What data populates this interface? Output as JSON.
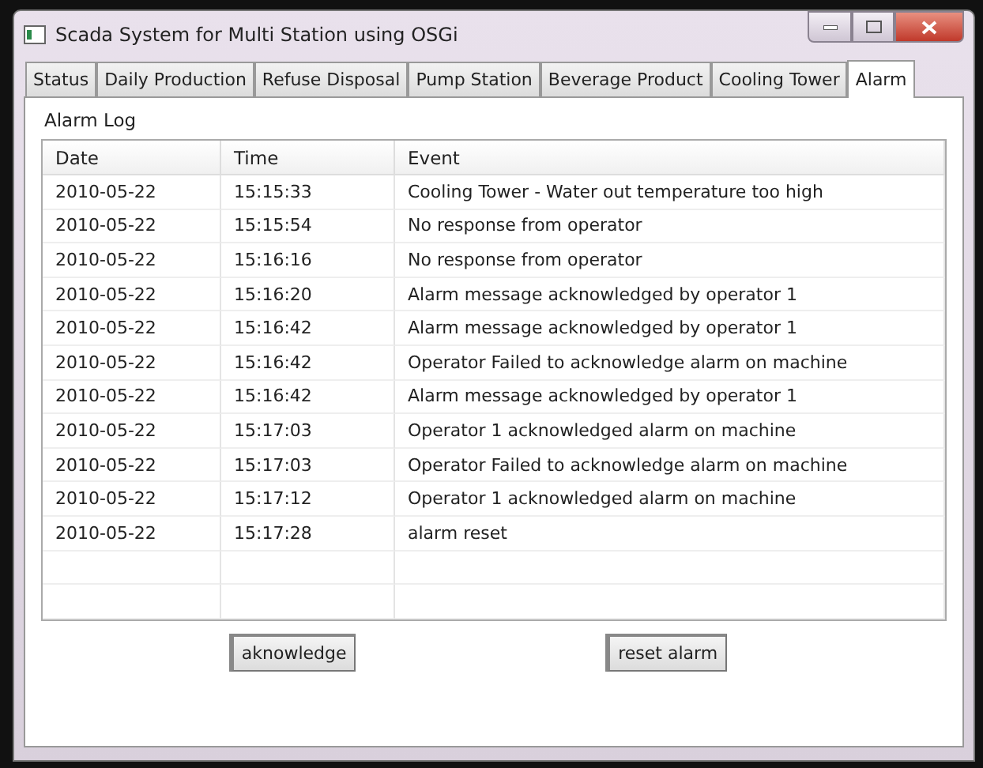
{
  "window": {
    "title": "Scada System for Multi Station using OSGi"
  },
  "tabs": [
    {
      "label": "Status",
      "selected": false
    },
    {
      "label": "Daily Production",
      "selected": false
    },
    {
      "label": "Refuse Disposal",
      "selected": false
    },
    {
      "label": "Pump Station",
      "selected": false
    },
    {
      "label": "Beverage Product",
      "selected": false
    },
    {
      "label": "Cooling Tower",
      "selected": false
    },
    {
      "label": "Alarm",
      "selected": true
    }
  ],
  "panel_title": "Alarm Log",
  "table": {
    "columns": [
      "Date",
      "Time",
      "Event"
    ],
    "rows": [
      [
        "2010-05-22",
        "15:15:33",
        "Cooling Tower - Water out temperature too high"
      ],
      [
        "2010-05-22",
        "15:15:54",
        "No response from operator"
      ],
      [
        "2010-05-22",
        "15:16:16",
        "No response from operator"
      ],
      [
        "2010-05-22",
        "15:16:20",
        "Alarm message acknowledged by operator 1"
      ],
      [
        "2010-05-22",
        "15:16:42",
        "Alarm message acknowledged by operator 1"
      ],
      [
        "2010-05-22",
        "15:16:42",
        "Operator Failed to acknowledge alarm on machine"
      ],
      [
        "2010-05-22",
        "15:16:42",
        "Alarm message acknowledged by operator 1"
      ],
      [
        "2010-05-22",
        "15:17:03",
        "Operator 1 acknowledged alarm on machine"
      ],
      [
        "2010-05-22",
        "15:17:03",
        "Operator Failed to acknowledge alarm on machine"
      ],
      [
        "2010-05-22",
        "15:17:12",
        "Operator 1 acknowledged alarm on machine"
      ],
      [
        "2010-05-22",
        "15:17:28",
        "alarm reset"
      ]
    ]
  },
  "buttons": [
    "aknowledge",
    "reset alarm"
  ]
}
